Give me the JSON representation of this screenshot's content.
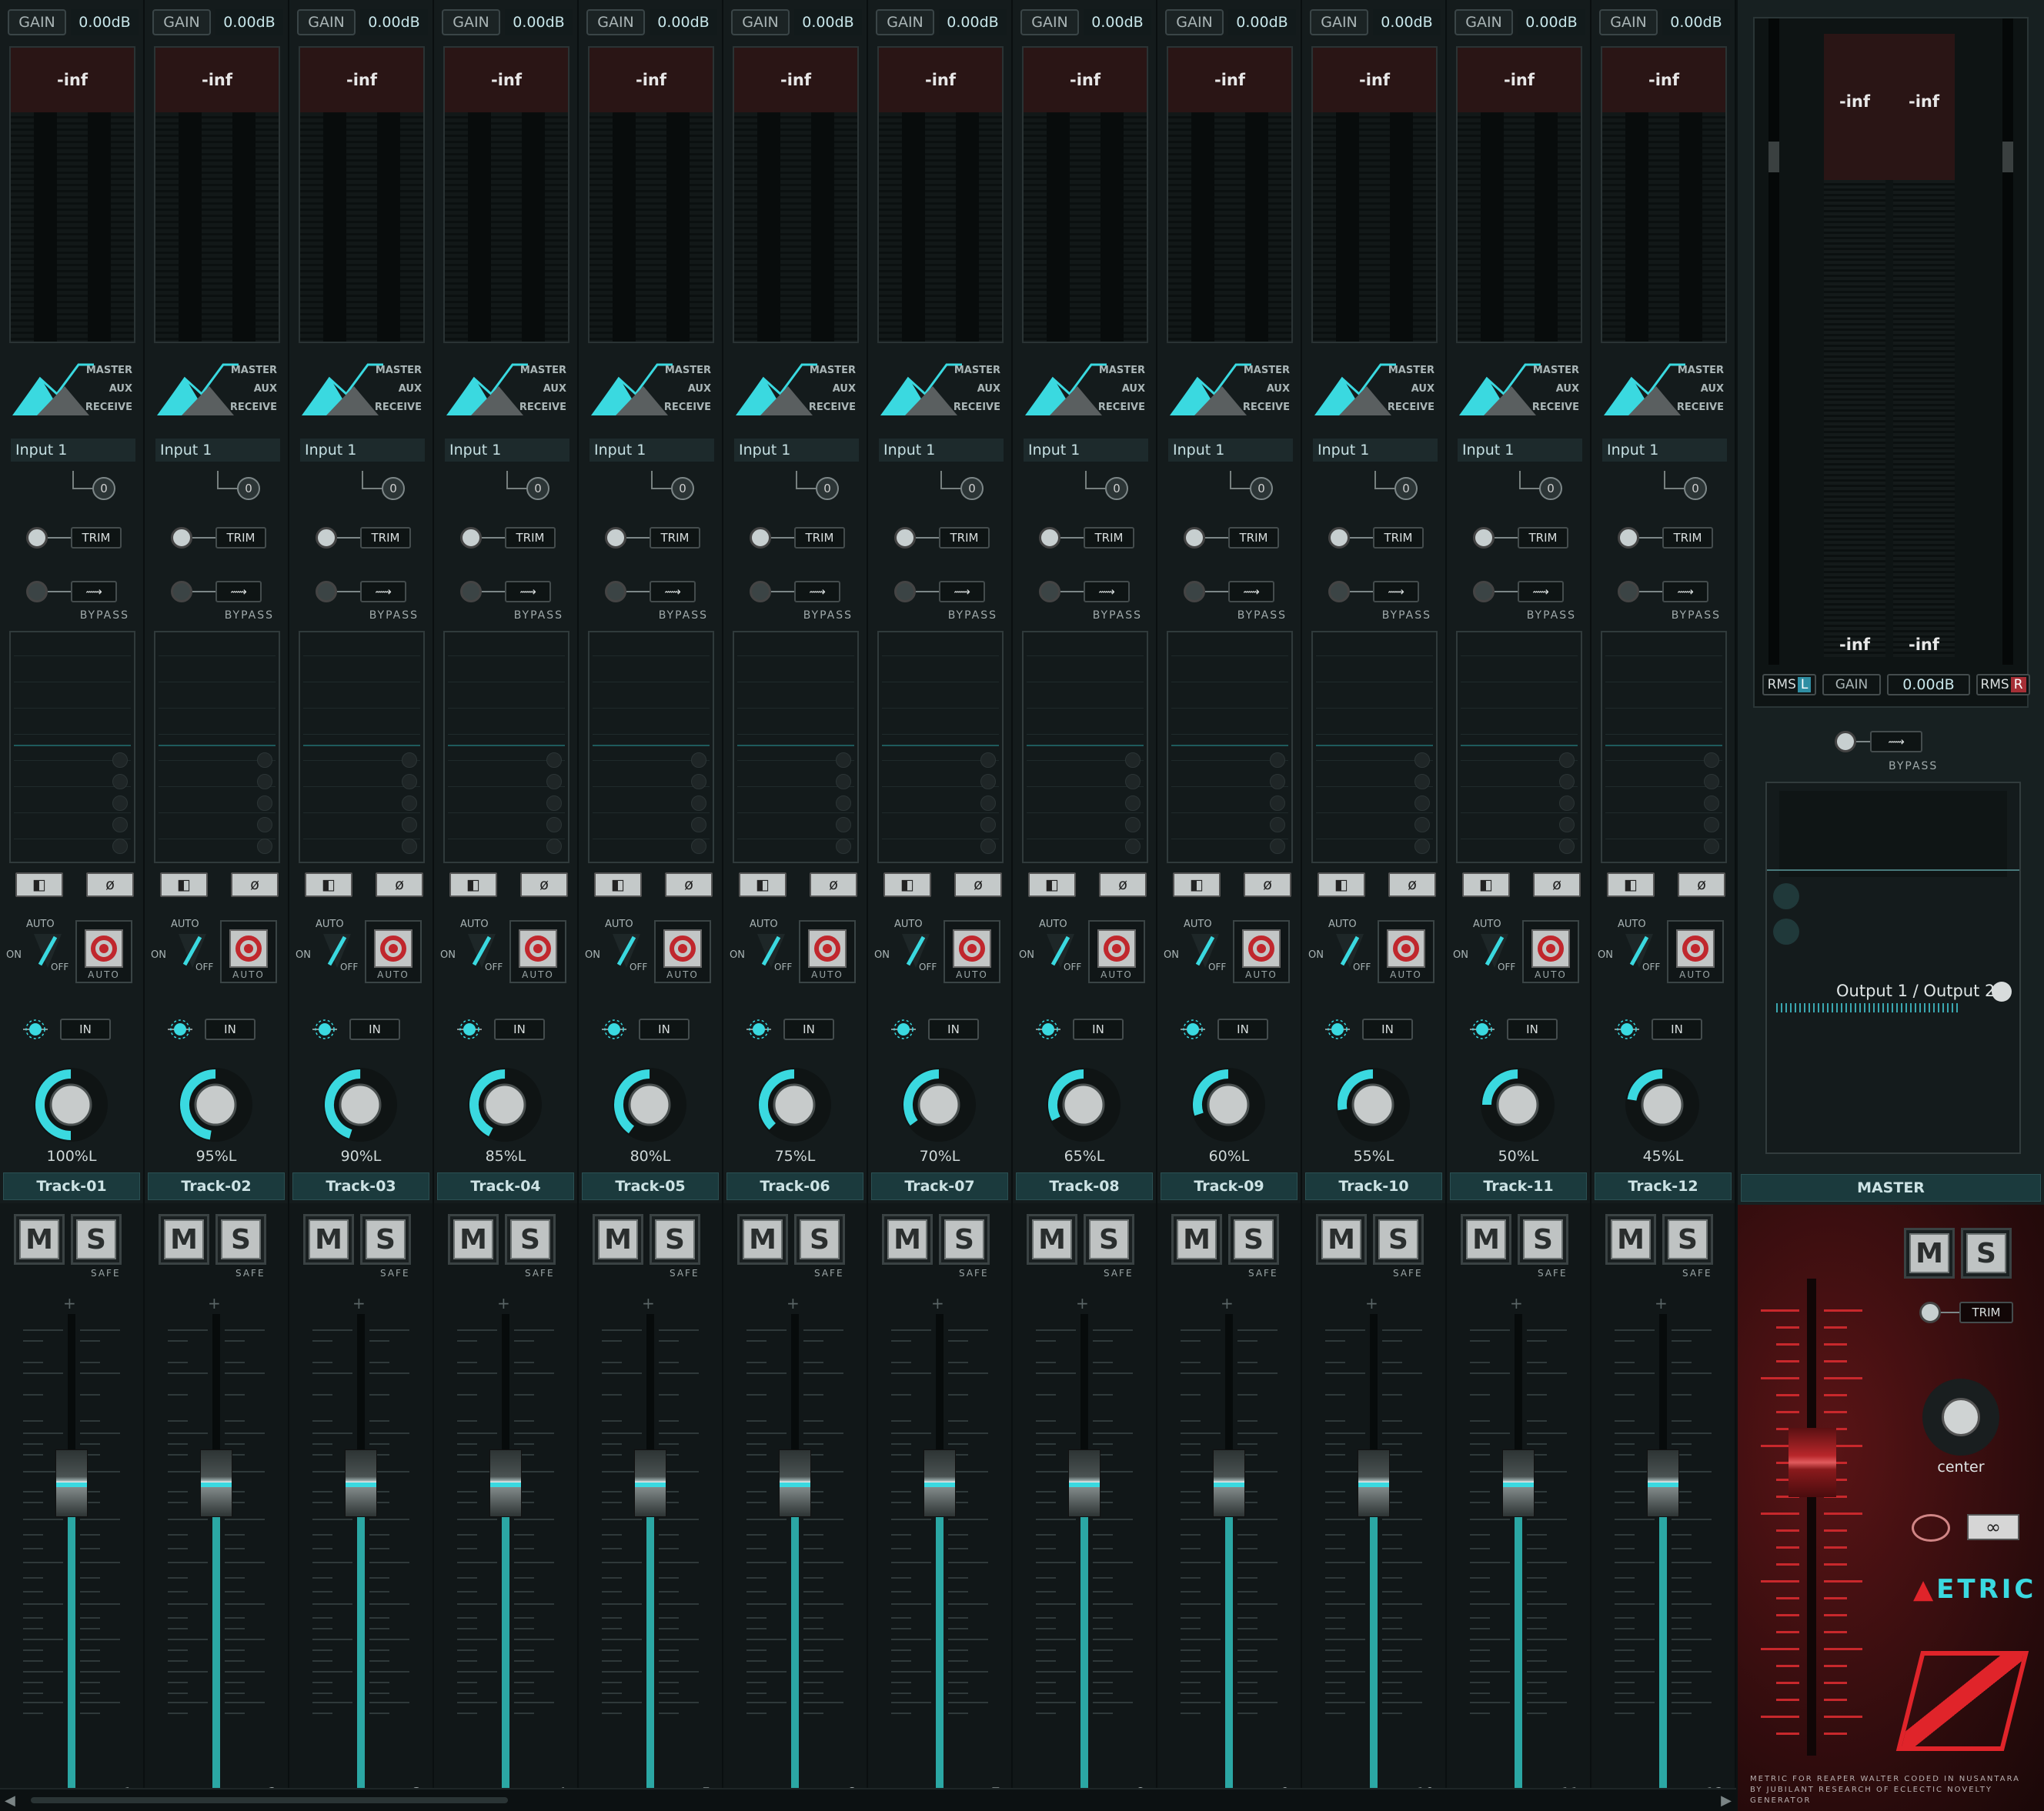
{
  "strip_common": {
    "gain_label": "GAIN",
    "gain_value": "0.00dB",
    "peak": "-inf",
    "routing": [
      "MASTER",
      "AUX",
      "RECEIVE"
    ],
    "input": "Input 1",
    "phase": "0",
    "trim": "TRIM",
    "bypass": "BYPASS",
    "auto": "AUTO",
    "on": "ON",
    "off": "OFF",
    "rec_auto": "AUTO",
    "in": "IN",
    "safe": "SAFE",
    "mute": "M",
    "solo": "S"
  },
  "tracks": [
    {
      "name": "Track-01",
      "number": "1",
      "pan": "100%L",
      "pan_fraction": 1.0
    },
    {
      "name": "Track-02",
      "number": "2",
      "pan": "95%L",
      "pan_fraction": 0.95
    },
    {
      "name": "Track-03",
      "number": "3",
      "pan": "90%L",
      "pan_fraction": 0.9
    },
    {
      "name": "Track-04",
      "number": "4",
      "pan": "85%L",
      "pan_fraction": 0.85
    },
    {
      "name": "Track-05",
      "number": "5",
      "pan": "80%L",
      "pan_fraction": 0.8
    },
    {
      "name": "Track-06",
      "number": "6",
      "pan": "75%L",
      "pan_fraction": 0.75
    },
    {
      "name": "Track-07",
      "number": "7",
      "pan": "70%L",
      "pan_fraction": 0.7
    },
    {
      "name": "Track-08",
      "number": "8",
      "pan": "65%L",
      "pan_fraction": 0.65
    },
    {
      "name": "Track-09",
      "number": "9",
      "pan": "60%L",
      "pan_fraction": 0.6
    },
    {
      "name": "Track-10",
      "number": "10",
      "pan": "55%L",
      "pan_fraction": 0.55
    },
    {
      "name": "Track-11",
      "number": "11",
      "pan": "50%L",
      "pan_fraction": 0.5
    },
    {
      "name": "Track-12",
      "number": "12",
      "pan": "45%L",
      "pan_fraction": 0.45
    }
  ],
  "master": {
    "name": "MASTER",
    "peak_left": "-inf",
    "peak_right": "-inf",
    "rms_left": "-inf",
    "rms_right": "-inf",
    "rms_label": "RMS",
    "rms_l": "L",
    "rms_r": "R",
    "gain_label": "GAIN",
    "gain_value": "0.00dB",
    "bypass": "BYPASS",
    "output": "Output 1 / Output 2",
    "mute": "M",
    "solo": "S",
    "trim": "TRIM",
    "pan": "center",
    "logo": "ETRIC",
    "footer": "METRIC FOR REAPER WALTER CODED IN NUSANTARA BY JUBILANT RESEARCH OF ECLECTIC NOVELTY GENERATOR"
  },
  "colors": {
    "accent": "#3ad9e0",
    "rec": "#c0272d",
    "master_red": "#e0242a"
  }
}
